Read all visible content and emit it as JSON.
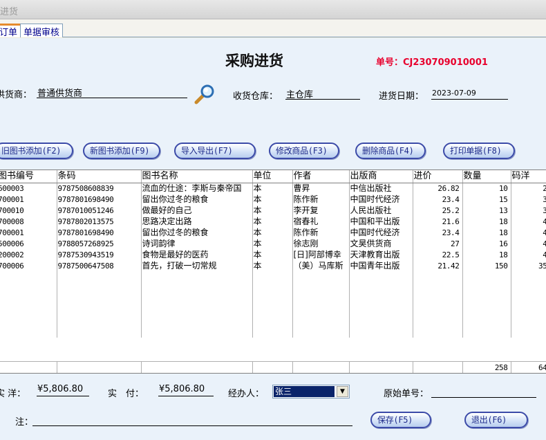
{
  "window": {
    "title": "进货"
  },
  "tabs": [
    {
      "label": "订单"
    },
    {
      "label": "单据审核"
    }
  ],
  "form": {
    "title": "采购进货",
    "order_no_label": "单号：",
    "order_no_value": "CJ230709010001",
    "supplier_label": "供货商：",
    "supplier_value": "普通供货商",
    "warehouse_label": "收货仓库：",
    "warehouse_value": "主仓库",
    "date_label": "进货日期：",
    "date_value": "2023-07-09"
  },
  "toolbar": {
    "add_old": "旧图书添加(F2)",
    "add_new": "新图书添加(F9)",
    "import_export": "导入导出(F7)",
    "modify": "修改商品(F3)",
    "delete": "删除商品(F4)",
    "print": "打印单据(F8)"
  },
  "table": {
    "columns": [
      "图书编号",
      "条码",
      "图书名称",
      "单位",
      "作者",
      "出版商",
      "进价",
      "数量",
      "码洋"
    ],
    "rows": [
      [
        "600003",
        "9787508608839",
        "流血的仕途：李斯与秦帝国",
        "本",
        "曹昇",
        "中信出版社",
        "26.82",
        "10",
        "2"
      ],
      [
        "700001",
        "9787801698490",
        "留出你过冬的粮食",
        "本",
        "陈作新",
        "中国时代经济",
        "23.4",
        "15",
        "3"
      ],
      [
        "700010",
        "9787010051246",
        "做最好的自己",
        "本",
        "李开复",
        "人民出版社",
        "25.2",
        "13",
        "3"
      ],
      [
        "700008",
        "9787802013575",
        "思路决定出路",
        "本",
        "宿春礼",
        "中国和平出版",
        "21.6",
        "18",
        "4"
      ],
      [
        "700001",
        "9787801698490",
        "留出你过冬的粮食",
        "本",
        "陈作新",
        "中国时代经济",
        "23.4",
        "18",
        "4"
      ],
      [
        "500006",
        "9788057268925",
        "诗词韵律",
        "本",
        "徐志刚",
        "文昊供货商",
        "27",
        "16",
        "4"
      ],
      [
        "200002",
        "9787530943519",
        "食物是最好的医药",
        "本",
        "[日]阿部博幸",
        "天津教育出版",
        "22.5",
        "18",
        "4"
      ],
      [
        "700006",
        "9787500647508",
        "首先，打破一切常规",
        "本",
        "（美）马库斯",
        "中国青年出版",
        "21.42",
        "150",
        "35"
      ]
    ],
    "totals": {
      "quantity": "258",
      "price": "64"
    }
  },
  "footer": {
    "actual_price_label": "实 洋：",
    "actual_price_value": "¥5,806.80",
    "paid_label": "实　付：",
    "paid_value": "¥5,806.80",
    "handler_label": "经办人：",
    "handler_value": "张三",
    "original_no_label": "原始单号：",
    "original_no_value": "",
    "note_label": "注：",
    "note_value": "",
    "save_button": "保存(F5)",
    "exit_button": "退出(F6)"
  },
  "colors": {
    "order_no": "#e8002d",
    "button_border": "#3b4aa8",
    "panel_bg": "#eaf2fa"
  }
}
